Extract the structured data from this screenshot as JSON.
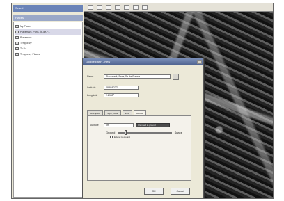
{
  "left_panel": {
    "search_title": "Search",
    "places_title": "Places",
    "tree": [
      {
        "label": "My Places"
      },
      {
        "label": "Placemark, Paris, Île-de-F..."
      },
      {
        "label": "Placemark"
      },
      {
        "label": "Temporary"
      },
      {
        "label": "To Do"
      },
      {
        "label": "Temporary Places"
      }
    ]
  },
  "dialog": {
    "title": "Google Earth - New",
    "name_label": "Name",
    "name_value": "Placemark, Paris, Île-de-France",
    "latitude_label": "Latitude",
    "latitude_value": "48.858222°",
    "longitude_label": "Longitude",
    "longitude_value": "2.2945°",
    "tabs": [
      "Description",
      "Style, Color",
      "View",
      "Altitude"
    ],
    "altitude_label": "Altitude",
    "altitude_value": "0m",
    "altitude_mode": "Clamped to ground",
    "slider_left": "Ground",
    "slider_right": "Space",
    "extend_label": "Extend to ground",
    "ok_label": "OK",
    "cancel_label": "Cancel"
  }
}
